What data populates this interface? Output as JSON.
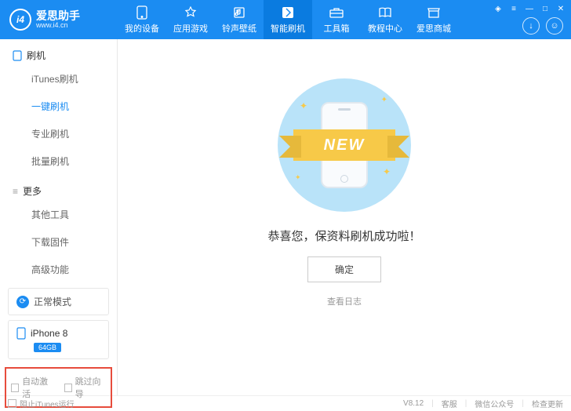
{
  "header": {
    "logo_text": "i4",
    "brand": "爱思助手",
    "site": "www.i4.cn",
    "nav": [
      {
        "label": "我的设备",
        "icon": "phone"
      },
      {
        "label": "应用游戏",
        "icon": "app"
      },
      {
        "label": "铃声壁纸",
        "icon": "music"
      },
      {
        "label": "智能刷机",
        "icon": "flash",
        "active": true
      },
      {
        "label": "工具箱",
        "icon": "toolbox"
      },
      {
        "label": "教程中心",
        "icon": "book"
      },
      {
        "label": "爱思商城",
        "icon": "store"
      }
    ]
  },
  "sidebar": {
    "section1": "刷机",
    "items1": [
      "iTunes刷机",
      "一键刷机",
      "专业刷机",
      "批量刷机"
    ],
    "active_item": "一键刷机",
    "section2": "更多",
    "items2": [
      "其他工具",
      "下载固件",
      "高级功能"
    ],
    "mode_label": "正常模式",
    "device_name": "iPhone 8",
    "device_storage": "64GB",
    "cb1": "自动激活",
    "cb2": "跳过向导"
  },
  "main": {
    "ribbon": "NEW",
    "success": "恭喜您，保资料刷机成功啦！",
    "ok": "确定",
    "log": "查看日志"
  },
  "footer": {
    "block_itunes": "阻止iTunes运行",
    "version": "V8.12",
    "support": "客服",
    "wechat": "微信公众号",
    "update": "检查更新"
  }
}
